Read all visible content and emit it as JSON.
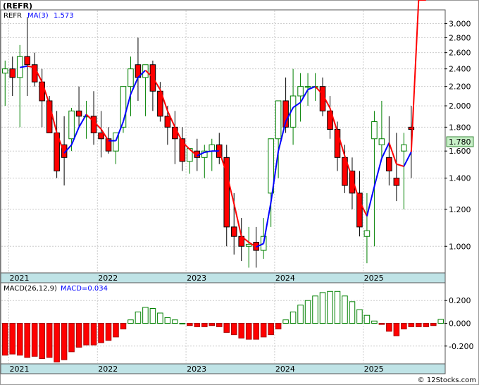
{
  "title": "(REFR)",
  "price_panel": {
    "legend": {
      "ticker": "REFR",
      "ma_label": "MA(3)",
      "ma_value": "1.573"
    },
    "last_price": "1.780",
    "y_ticks": [
      "3.000",
      "2.800",
      "2.600",
      "2.400",
      "2.200",
      "2.000",
      "1.800",
      "1.600",
      "1.400",
      "1.200",
      "1.000"
    ],
    "x_ticks": [
      "2021",
      "2022",
      "2023",
      "2024",
      "2025"
    ]
  },
  "macd_panel": {
    "legend": {
      "label": "MACD(26,12,9)",
      "value_label": "MACD=0.034"
    },
    "y_ticks": [
      "0.200",
      "0.000",
      "-0.200"
    ],
    "x_ticks": [
      "2021",
      "2022",
      "2023",
      "2024",
      "2025"
    ]
  },
  "footer": {
    "credit": "© 12Stocks.com"
  },
  "colors": {
    "up": "#008000",
    "down": "#ff0000",
    "ma_up": "#0000ff",
    "ma_down": "#ff0000",
    "macd_axis_band": "#bfe3e6",
    "last_price_box": "#c8f0c8"
  },
  "chart_data": [
    {
      "type": "candlestick",
      "title": "(REFR)",
      "scale": "log",
      "ylim": [
        0.88,
        3.2
      ],
      "x_period": "monthly",
      "x": [
        "2020-12",
        "2021-01",
        "2021-02",
        "2021-03",
        "2021-04",
        "2021-05",
        "2021-06",
        "2021-07",
        "2021-08",
        "2021-09",
        "2021-10",
        "2021-11",
        "2021-12",
        "2022-01",
        "2022-02",
        "2022-03",
        "2022-04",
        "2022-05",
        "2022-06",
        "2022-07",
        "2022-08",
        "2022-09",
        "2022-10",
        "2022-11",
        "2022-12",
        "2023-01",
        "2023-02",
        "2023-03",
        "2023-04",
        "2023-05",
        "2023-06",
        "2023-07",
        "2023-08",
        "2023-09",
        "2023-10",
        "2023-11",
        "2023-12",
        "2024-01",
        "2024-02",
        "2024-03",
        "2024-04",
        "2024-05",
        "2024-06",
        "2024-07",
        "2024-08",
        "2024-09",
        "2024-10",
        "2024-11",
        "2024-12",
        "2025-01",
        "2025-02",
        "2025-03",
        "2025-04",
        "2025-05",
        "2025-06",
        "2025-07",
        "2025-08",
        "2025-09"
      ],
      "open": [
        2.35,
        2.4,
        2.3,
        2.55,
        2.45,
        2.25,
        2.05,
        1.75,
        1.65,
        1.7,
        1.95,
        1.9,
        1.9,
        1.75,
        1.7,
        1.6,
        1.8,
        2.2,
        2.45,
        2.3,
        2.45,
        2.15,
        1.9,
        1.8,
        1.7,
        1.52,
        1.6,
        1.55,
        1.6,
        1.65,
        1.55,
        1.1,
        1.05,
        1.0,
        1.02,
        0.98,
        1.3,
        1.7,
        2.05,
        1.8,
        2.1,
        2.2,
        2.2,
        2.2,
        1.95,
        1.78,
        1.55,
        1.45,
        1.3,
        1.05,
        1.7,
        1.65,
        1.55,
        1.4,
        1.6,
        1.8
      ],
      "high": [
        2.5,
        2.55,
        2.7,
        3.1,
        2.6,
        2.4,
        2.1,
        1.95,
        1.9,
        1.98,
        2.2,
        2.05,
        2.15,
        1.95,
        1.8,
        1.7,
        2.0,
        2.55,
        2.8,
        2.45,
        2.5,
        2.25,
        2.0,
        1.95,
        1.8,
        1.62,
        1.7,
        1.65,
        1.7,
        1.75,
        1.65,
        1.3,
        1.15,
        1.1,
        1.1,
        1.15,
        1.5,
        2.05,
        2.3,
        2.4,
        2.35,
        2.35,
        2.35,
        2.3,
        2.1,
        1.85,
        1.65,
        1.55,
        1.45,
        1.3,
        1.95,
        2.05,
        1.9,
        1.75,
        1.75,
        2.0
      ],
      "low": [
        2.0,
        2.1,
        1.8,
        2.1,
        2.2,
        1.8,
        1.8,
        1.4,
        1.35,
        1.6,
        1.8,
        1.7,
        1.65,
        1.55,
        1.58,
        1.5,
        1.75,
        1.9,
        2.05,
        1.9,
        1.95,
        1.85,
        1.65,
        1.5,
        1.45,
        1.43,
        1.45,
        1.4,
        1.45,
        1.5,
        1.0,
        0.96,
        0.93,
        0.9,
        0.9,
        0.94,
        1.1,
        1.4,
        1.75,
        1.65,
        1.85,
        2.0,
        2.05,
        1.9,
        1.7,
        1.45,
        1.3,
        1.2,
        1.05,
        0.92,
        1.0,
        1.55,
        1.35,
        1.25,
        1.2,
        1.4
      ],
      "close": [
        2.4,
        2.3,
        2.55,
        2.45,
        2.25,
        2.05,
        1.75,
        1.45,
        1.55,
        1.95,
        1.9,
        1.9,
        1.75,
        1.7,
        1.6,
        1.75,
        2.2,
        2.4,
        2.3,
        2.45,
        2.15,
        1.9,
        1.8,
        1.7,
        1.52,
        1.62,
        1.55,
        1.6,
        1.65,
        1.55,
        1.1,
        1.05,
        1.0,
        1.01,
        0.98,
        1.05,
        1.7,
        2.05,
        1.8,
        2.1,
        2.2,
        2.2,
        2.2,
        1.95,
        1.78,
        1.55,
        1.35,
        1.3,
        1.1,
        1.08,
        1.85,
        1.7,
        1.45,
        1.35,
        1.65,
        1.78
      ],
      "ma_label": "MA(3)",
      "ma_last": 1.573,
      "last": 1.78,
      "x_tick_labels": [
        "2021",
        "2022",
        "2023",
        "2024",
        "2025"
      ],
      "y_tick_labels": [
        3.0,
        2.8,
        2.6,
        2.4,
        2.2,
        2.0,
        1.8,
        1.6,
        1.4,
        1.2,
        1.0
      ]
    },
    {
      "type": "bar",
      "title": "MACD(26,12,9)",
      "value_label": "MACD=0.034",
      "ylim": [
        -0.35,
        0.35
      ],
      "values": [
        -0.28,
        -0.27,
        -0.28,
        -0.3,
        -0.29,
        -0.31,
        -0.3,
        -0.34,
        -0.32,
        -0.25,
        -0.21,
        -0.19,
        -0.19,
        -0.17,
        -0.15,
        -0.12,
        -0.05,
        0.03,
        0.1,
        0.14,
        0.13,
        0.09,
        0.05,
        0.03,
        0.0,
        -0.02,
        -0.03,
        -0.03,
        -0.02,
        -0.03,
        -0.08,
        -0.1,
        -0.13,
        -0.14,
        -0.14,
        -0.12,
        -0.1,
        -0.05,
        0.03,
        0.1,
        0.16,
        0.2,
        0.24,
        0.27,
        0.28,
        0.28,
        0.24,
        0.19,
        0.12,
        0.07,
        0.02,
        -0.01,
        -0.07,
        -0.11,
        -0.05,
        -0.03,
        -0.03,
        -0.03,
        -0.02,
        0.034
      ],
      "x_tick_labels": [
        "2021",
        "2022",
        "2023",
        "2024",
        "2025"
      ],
      "y_tick_labels": [
        0.2,
        0.0,
        -0.2
      ]
    }
  ]
}
